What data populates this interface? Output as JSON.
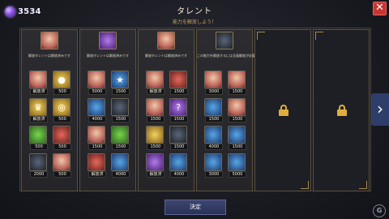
{
  "currency": {
    "value": "3534",
    "icon": "gem-icon"
  },
  "header": {
    "title": "タレント",
    "subtitle": "能力を解放しよう！"
  },
  "close_label": "✕",
  "columns": [
    {
      "label": "解放タレントは解放済みです",
      "head_icon": "hero-portrait-icon",
      "rows": [
        [
          {
            "icon": "hero-face",
            "value": "解放済"
          },
          {
            "icon": "coin",
            "value": "500"
          }
        ],
        [
          {
            "icon": "shield",
            "value": "解放済"
          },
          {
            "icon": "coin-stack",
            "value": "500"
          }
        ],
        [
          {
            "icon": "green-skill",
            "value": "500"
          },
          {
            "icon": "red-skill",
            "value": "500"
          }
        ],
        [
          {
            "icon": "dark-skill",
            "value": "2000"
          },
          {
            "icon": "hero-dark",
            "value": "500"
          }
        ]
      ]
    },
    {
      "label": "解放タレントは解放済みです",
      "head_icon": "purple-orb-icon",
      "rows": [
        [
          {
            "icon": "hero-face",
            "value": "5000"
          },
          {
            "icon": "wizard",
            "value": "1500"
          }
        ],
        [
          {
            "icon": "blue-skill",
            "value": "4000"
          },
          {
            "icon": "dark-skill",
            "value": "1500"
          }
        ],
        [
          {
            "icon": "hero-face",
            "value": "1500"
          },
          {
            "icon": "green-hero",
            "value": "1500"
          }
        ],
        [
          {
            "icon": "red-hero",
            "value": "解放済"
          },
          {
            "icon": "blue-skill",
            "value": "4000"
          }
        ]
      ]
    },
    {
      "label": "解放タレントは解放済みです",
      "head_icon": "hero-portrait-icon",
      "rows": [
        [
          {
            "icon": "hero-face",
            "value": "解放済"
          },
          {
            "icon": "hero-red",
            "value": "1500"
          }
        ],
        [
          {
            "icon": "hero-face",
            "value": "1500"
          },
          {
            "icon": "question",
            "value": "1500"
          }
        ],
        [
          {
            "icon": "hero-gold",
            "value": "1500"
          },
          {
            "icon": "dark-skill",
            "value": "1500"
          }
        ],
        [
          {
            "icon": "purple-skill",
            "value": "解放済"
          },
          {
            "icon": "blue-skill",
            "value": "4000"
          }
        ]
      ]
    },
    {
      "label": "この能力を解放するには全員解放が必要です",
      "head_icon": "dark-orb-icon",
      "rows": [
        [
          {
            "icon": "hero-face",
            "value": "3000"
          },
          {
            "icon": "hero-face",
            "value": "1500"
          }
        ],
        [
          {
            "icon": "blue-skill",
            "value": "1500"
          },
          {
            "icon": "hero-face",
            "value": "1500"
          }
        ],
        [
          {
            "icon": "blue-skill",
            "value": "4000"
          },
          {
            "icon": "blue-skill",
            "value": "1500"
          }
        ],
        [
          {
            "icon": "hero-blue",
            "value": "3000"
          },
          {
            "icon": "blue-skill",
            "value": "5000"
          }
        ]
      ]
    }
  ],
  "locked_columns": [
    {
      "icon": "lock-icon"
    },
    {
      "icon": "lock-icon"
    }
  ],
  "next_label": "›",
  "confirm_label": "決定",
  "watermark": "G"
}
